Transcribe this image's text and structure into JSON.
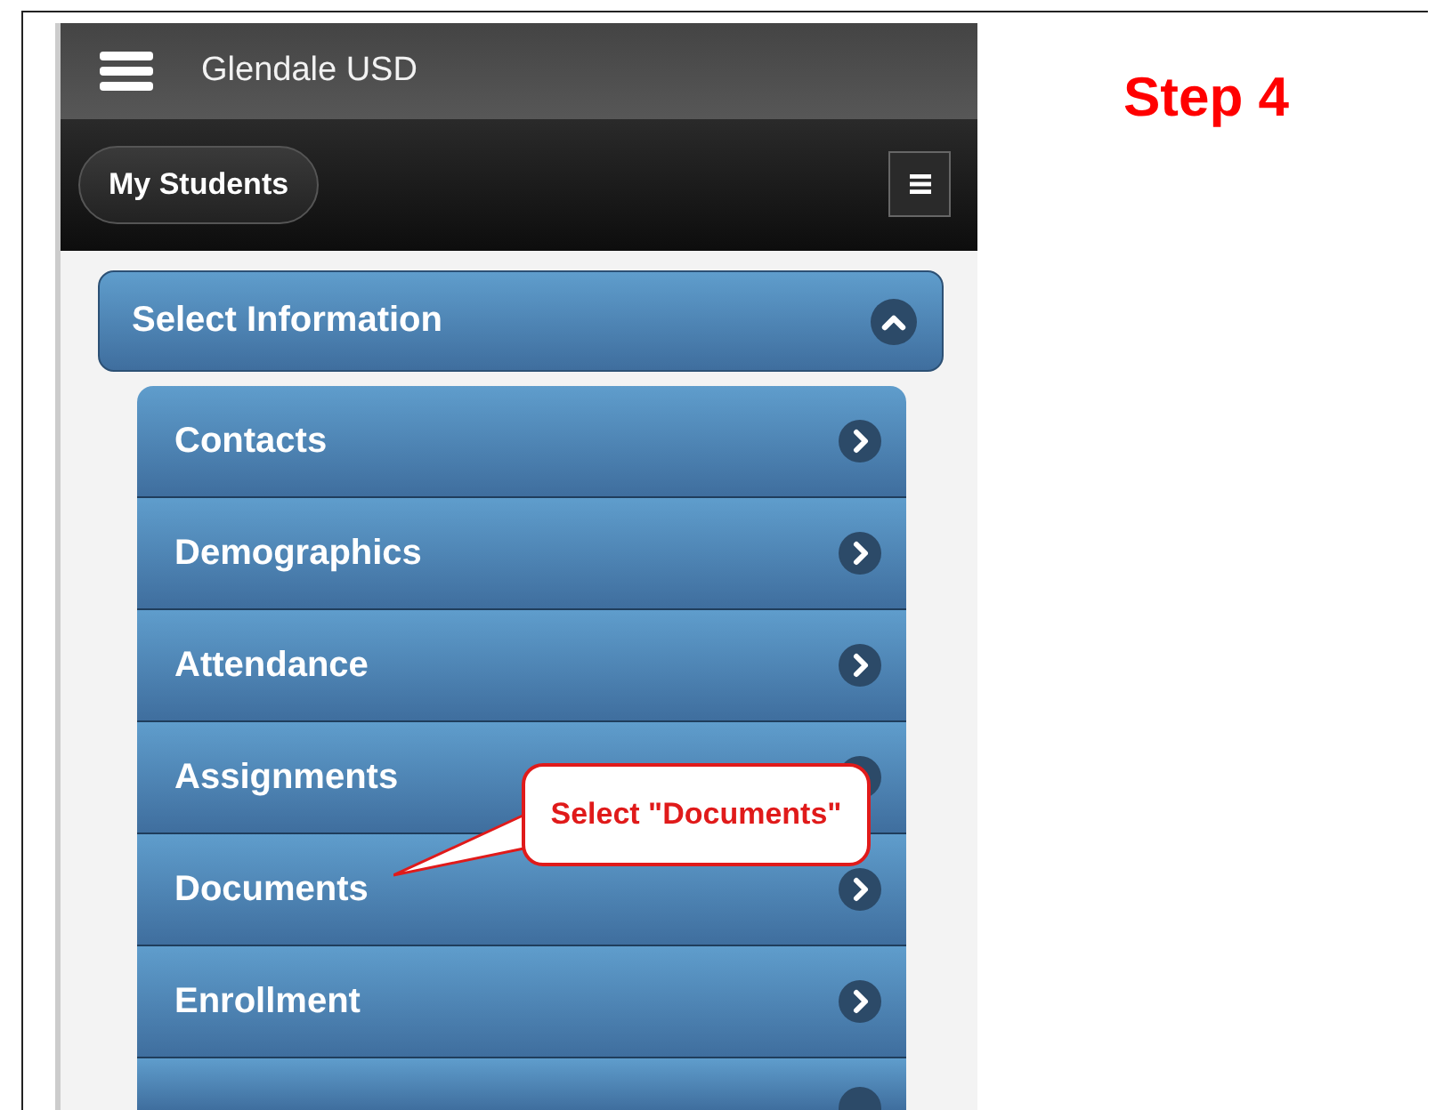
{
  "app_header": {
    "title": "Glendale USD"
  },
  "toolbar": {
    "button": "My Students"
  },
  "section": {
    "title": "Select Information",
    "expanded": true
  },
  "menu_items": [
    {
      "label": "Contacts"
    },
    {
      "label": "Demographics"
    },
    {
      "label": "Attendance"
    },
    {
      "label": "Assignments"
    },
    {
      "label": "Documents",
      "callout": "Select \"Documents\""
    },
    {
      "label": "Enrollment"
    }
  ],
  "cut_off_row": true,
  "step_label": "Step 4"
}
